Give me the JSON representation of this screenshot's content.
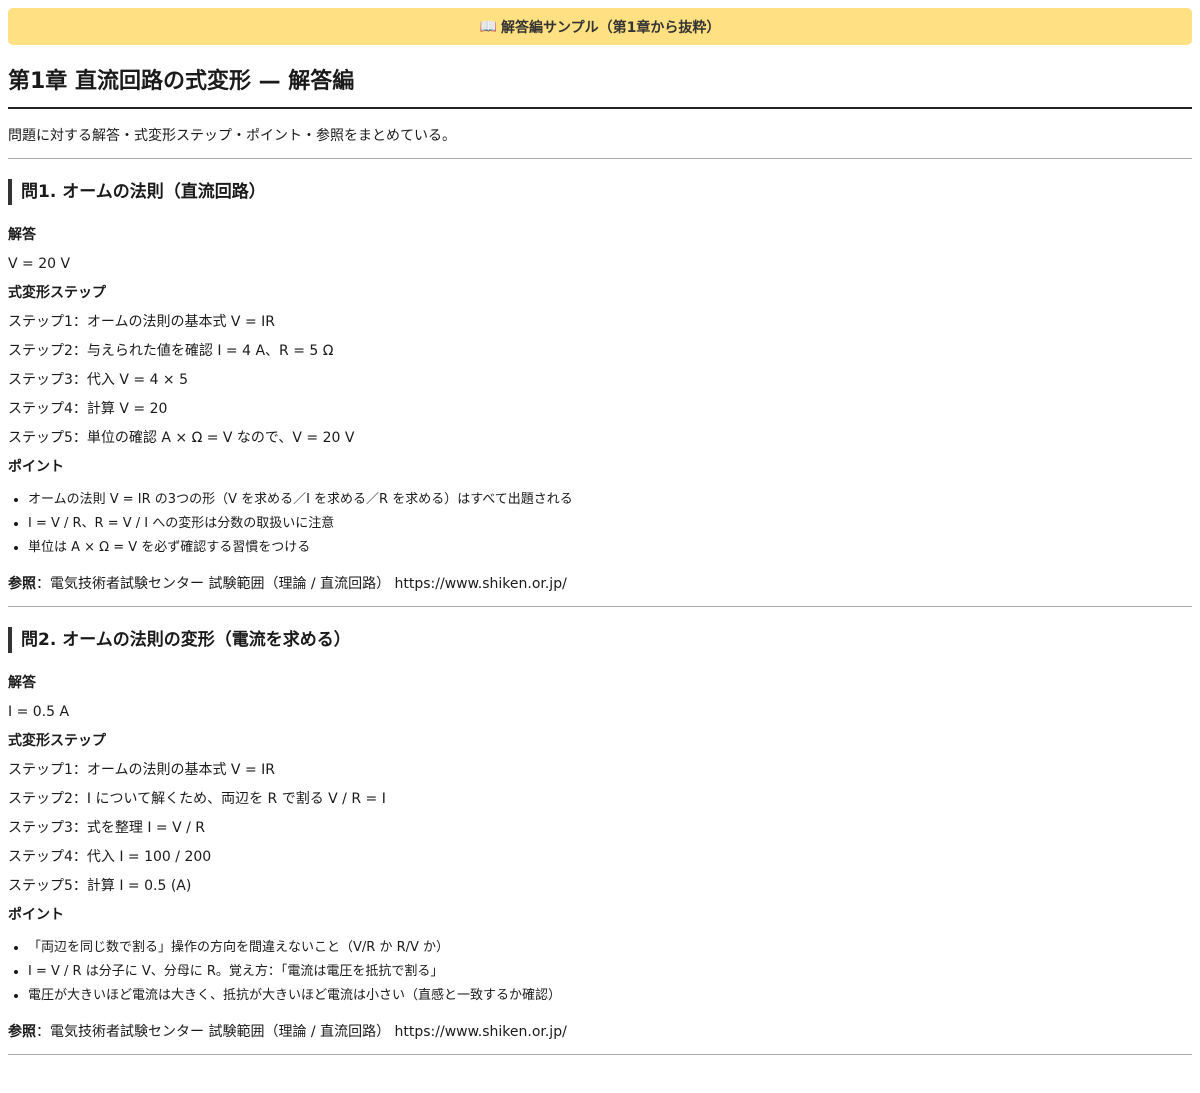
{
  "banner": {
    "icon": "book-icon",
    "text": "解答編サンプル（第1章から抜粋）"
  },
  "title": "第1章 直流回路の式変形 — 解答編",
  "intro": "問題に対する解答・式変形ステップ・ポイント・参照をまとめている。",
  "labels": {
    "answer": "解答",
    "steps": "式変形ステップ",
    "points": "ポイント",
    "ref": "参照"
  },
  "questions": [
    {
      "heading": "問1. オームの法則（直流回路）",
      "answer": "V = 20 V",
      "steps": [
        "ステップ1：オームの法則の基本式 V = IR",
        "ステップ2：与えられた値を確認 I = 4 A、R = 5 Ω",
        "ステップ3：代入 V = 4 × 5",
        "ステップ4：計算 V = 20",
        "ステップ5：単位の確認 A × Ω = V なので、V = 20 V"
      ],
      "points": [
        "オームの法則 V = IR の3つの形（V を求める／I を求める／R を求める）はすべて出題される",
        "I = V / R、R = V / I への変形は分数の取扱いに注意",
        "単位は A × Ω = V を必ず確認する習慣をつける"
      ],
      "ref": "：電気技術者試験センター 試験範囲（理論 / 直流回路） https://www.shiken.or.jp/"
    },
    {
      "heading": "問2. オームの法則の変形（電流を求める）",
      "answer": "I = 0.5 A",
      "steps": [
        "ステップ1：オームの法則の基本式 V = IR",
        "ステップ2：I について解くため、両辺を R で割る V / R = I",
        "ステップ3：式を整理 I = V / R",
        "ステップ4：代入 I = 100 / 200",
        "ステップ5：計算 I = 0.5 (A)"
      ],
      "points": [
        "「両辺を同じ数で割る」操作の方向を間違えないこと（V/R か R/V か）",
        "I = V / R は分子に V、分母に R。覚え方：「電流は電圧を抵抗で割る」",
        "電圧が大きいほど電流は大きく、抵抗が大きいほど電流は小さい（直感と一致するか確認）"
      ],
      "ref": "：電気技術者試験センター 試験範囲（理論 / 直流回路） https://www.shiken.or.jp/"
    }
  ]
}
